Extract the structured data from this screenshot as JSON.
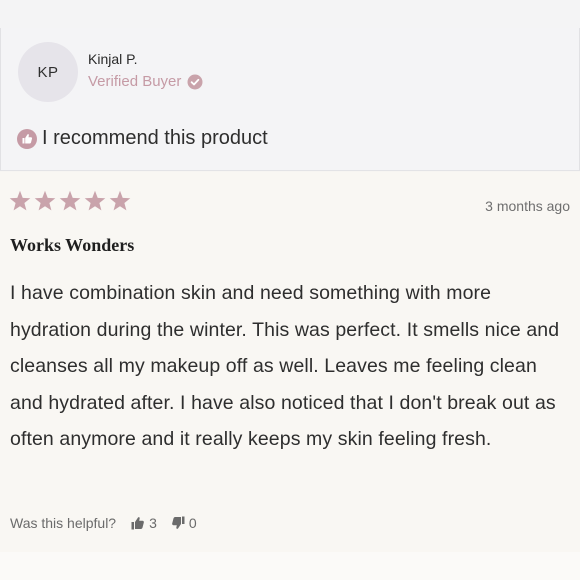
{
  "reviewer": {
    "initials": "KP",
    "name": "Kinjal P.",
    "verified_label": "Verified Buyer"
  },
  "recommendation": "I recommend this product",
  "review": {
    "rating": 5,
    "rating_max": 5,
    "date": "3 months ago",
    "title": "Works Wonders",
    "text": "I have combination skin and need something with more hydration during the winter. This was perfect. It smells nice and cleanses all my makeup off as well. Leaves me feeling clean and hydrated after. I have also noticed that I don't break out as often anymore and it really keeps my skin feeling fresh."
  },
  "helpful": {
    "label": "Was this helpful?",
    "upvotes": "3",
    "downvotes": "0"
  },
  "colors": {
    "accent": "#c59aa5",
    "star": "#c9a3ab"
  }
}
